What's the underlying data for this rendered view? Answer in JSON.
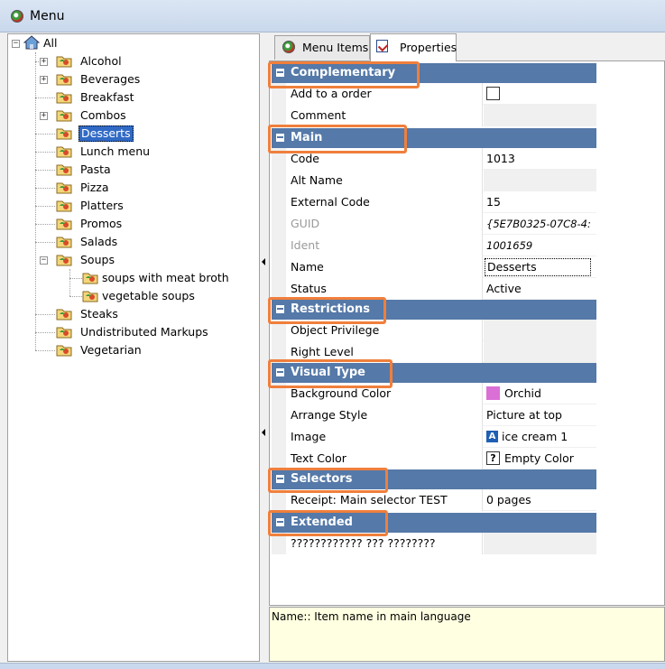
{
  "window": {
    "title": "Menu"
  },
  "tree": {
    "root": "All",
    "items": [
      {
        "label": "Alcohol"
      },
      {
        "label": "Beverages"
      },
      {
        "label": "Breakfast"
      },
      {
        "label": "Combos"
      },
      {
        "label": "Desserts"
      },
      {
        "label": "Lunch menu"
      },
      {
        "label": "Pasta"
      },
      {
        "label": "Pizza"
      },
      {
        "label": "Platters"
      },
      {
        "label": "Promos"
      },
      {
        "label": "Salads"
      },
      {
        "label": "Soups"
      },
      {
        "label": "soups with meat broth"
      },
      {
        "label": "vegetable soups"
      },
      {
        "label": "Steaks"
      },
      {
        "label": "Undistributed Markups"
      },
      {
        "label": "Vegetarian"
      }
    ],
    "selected": "Desserts"
  },
  "tabs": [
    {
      "label": "Menu Items"
    },
    {
      "label": "Properties"
    }
  ],
  "properties": {
    "complementary": {
      "title": "Complementary",
      "add_to_order": "Add to a order",
      "comment": "Comment"
    },
    "main": {
      "title": "Main",
      "code_label": "Code",
      "code_value": "1013",
      "alt_name_label": "Alt Name",
      "external_code_label": "External Code",
      "external_code_value": "15",
      "guid_label": "GUID",
      "guid_value": "{5E7B0325-07C8-4:",
      "ident_label": "Ident",
      "ident_value": "1001659",
      "name_label": "Name",
      "name_value": "Desserts",
      "status_label": "Status",
      "status_value": "Active"
    },
    "restrictions": {
      "title": "Restrictions",
      "object_privilege": "Object Privilege",
      "right_level": "Right Level"
    },
    "visual_type": {
      "title": "Visual Type",
      "background_color_label": "Background Color",
      "background_color_value": "Orchid",
      "background_color_hex": "#da70d6",
      "arrange_style_label": "Arrange Style",
      "arrange_style_value": "Picture at top",
      "image_label": "Image",
      "image_value": "ice cream 1",
      "text_color_label": "Text Color",
      "text_color_value": "Empty Color"
    },
    "selectors": {
      "title": "Selectors",
      "receipt_label": "Receipt: Main selector TEST",
      "receipt_value": "0 pages"
    },
    "extended": {
      "title": "Extended",
      "unknown_label": "???????????? ??? ????????"
    }
  },
  "description": {
    "text": "Name:: Item name in main language"
  },
  "colors": {
    "section_header": "#5579a8",
    "highlight": "#f07f3c",
    "selection": "#316ac5"
  }
}
